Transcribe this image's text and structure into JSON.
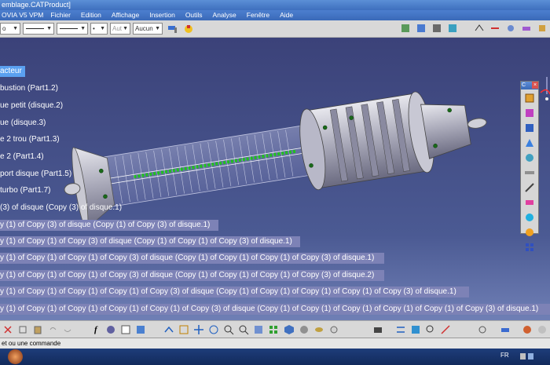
{
  "window": {
    "title": "emblage.CATProduct]",
    "app_name": "OVIA V5 VPM"
  },
  "menu": [
    "Fichier",
    "Edition",
    "Affichage",
    "Insertion",
    "Outils",
    "Analyse",
    "Fenêtre",
    "Aide"
  ],
  "toolbar": {
    "combo_first": "o",
    "combo_dot": "•",
    "combo_aut": "Aut",
    "combo_layer": "Aucun"
  },
  "tree": [
    {
      "label": "acteur",
      "state": "selected"
    },
    {
      "label": "bustion  (Part1.2)",
      "state": "normal"
    },
    {
      "label": "ue petit (disque.2)",
      "state": "normal"
    },
    {
      "label": "ue (disque.3)",
      "state": "normal"
    },
    {
      "label": "e 2 trou (Part1.3)",
      "state": "normal"
    },
    {
      "label": "e 2 (Part1.4)",
      "state": "normal"
    },
    {
      "label": "port disque (Part1.5)",
      "state": "normal"
    },
    {
      "label": "turbo (Part1.7)",
      "state": "normal"
    },
    {
      "label": "(3) of disque (Copy (3) of disque.1)",
      "state": "normal"
    },
    {
      "label": "y (1) of Copy (3) of disque (Copy (1) of Copy (3) of disque.1)",
      "state": "hl"
    },
    {
      "label": "y (1) of Copy (1) of Copy (3) of disque (Copy (1) of Copy (1) of Copy (3) of disque.1)",
      "state": "hl"
    },
    {
      "label": "y (1) of Copy (1) of Copy (1) of Copy (3) of disque (Copy (1) of Copy (1) of Copy (1) of Copy (3) of disque.1)",
      "state": "hl"
    },
    {
      "label": "y (1) of Copy (1) of Copy (1) of Copy (3) of disque (Copy (1) of Copy (1) of Copy (1) of Copy (3) of disque.2)",
      "state": "hl"
    },
    {
      "label": "y (1) of Copy (1) of Copy (1) of Copy (1) of Copy (3) of disque (Copy (1) of Copy (1) of Copy (1) of Copy (1) of Copy (3) of disque.1)",
      "state": "hl"
    },
    {
      "label": "y (1) of Copy (1) of Copy (1) of Copy (1) of Copy (1) of Copy (3) of disque (Copy (1) of Copy (1) of Copy (1) of Copy (1) of Copy (1) of Copy (3) of disque.1)",
      "state": "hl"
    }
  ],
  "workbench_panel": {
    "title": "C"
  },
  "status": {
    "message": "et ou une commande"
  },
  "taskbar": {
    "language": "FR"
  },
  "colors": {
    "viewport_top": "#3b4279",
    "tree_selected": "#5aa0f0",
    "tree_highlight": "#7d82b6",
    "part_grey": "#c8c8d0",
    "wire_green": "#20c020"
  }
}
